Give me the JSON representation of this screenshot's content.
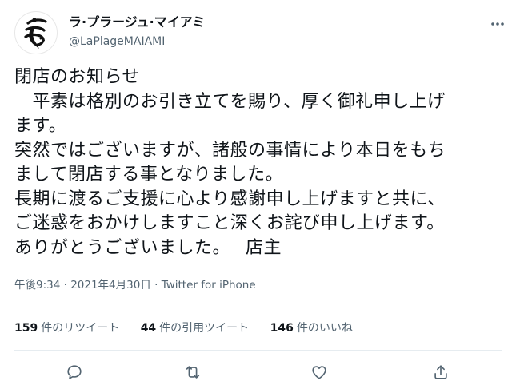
{
  "tweet": {
    "display_name": "ラ·プラージュ·マイアミ",
    "handle": "@LaPlageMAIAMI",
    "text": "閉店のお知らせ\n　平素は格別のお引き立てを賜り、厚く御礼申し上げ\nます。\n突然ではございますが、諸般の事情により本日をもち\nまして閉店する事となりました。\n長期に渡るご支援に心より感謝申し上げますと共に、\nご迷惑をおかけしますこと深くお詫び申し上げます。\nありがとうございました。　 店主",
    "time": "午後9:34",
    "date": "2021年4月30日",
    "source": "Twitter for iPhone",
    "separator": " · "
  },
  "stats": {
    "retweets": {
      "num": "159",
      "label": "件のリツイート"
    },
    "quotes": {
      "num": "44",
      "label": "件の引用ツイート"
    },
    "likes": {
      "num": "146",
      "label": "件のいいね"
    }
  },
  "icons": {
    "more": "more-icon",
    "reply": "reply-icon",
    "retweet": "retweet-icon",
    "like": "like-icon",
    "share": "share-icon"
  },
  "colors": {
    "text": "#0f1419",
    "secondary": "#536471",
    "divider": "#e6ecf0"
  }
}
